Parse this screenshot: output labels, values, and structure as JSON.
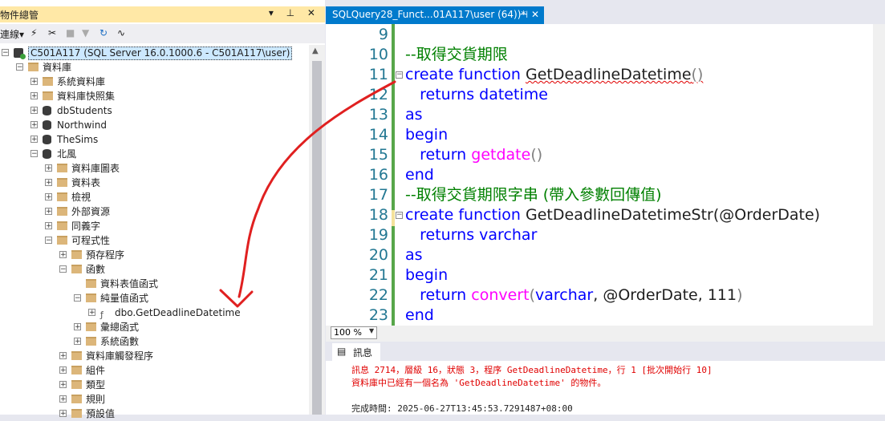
{
  "object_explorer": {
    "title": "物件總管",
    "toolbar_connect": "連線▾",
    "pin_buttons": "▾ ⊥ ✕",
    "tree": [
      {
        "label": "C501A117 (SQL Server 16.0.1000.6 - C501A117\\user)",
        "icon": "server-icon",
        "expand": "−",
        "selected": true
      },
      {
        "label": "資料庫",
        "icon": "folder-icon",
        "expand": "−"
      },
      {
        "label": "系統資料庫",
        "icon": "folder-icon",
        "expand": "+"
      },
      {
        "label": "資料庫快照集",
        "icon": "folder-icon",
        "expand": "+"
      },
      {
        "label": "dbStudents",
        "icon": "database-icon",
        "expand": "+"
      },
      {
        "label": "Northwind",
        "icon": "database-icon",
        "expand": "+"
      },
      {
        "label": "TheSims",
        "icon": "database-icon",
        "expand": "+"
      },
      {
        "label": "北風",
        "icon": "database-icon",
        "expand": "−"
      },
      {
        "label": "資料庫圖表",
        "icon": "folder-icon",
        "expand": "+"
      },
      {
        "label": "資料表",
        "icon": "folder-icon",
        "expand": "+"
      },
      {
        "label": "檢視",
        "icon": "folder-icon",
        "expand": "+"
      },
      {
        "label": "外部資源",
        "icon": "folder-icon",
        "expand": "+"
      },
      {
        "label": "同義字",
        "icon": "folder-icon",
        "expand": "+"
      },
      {
        "label": "可程式性",
        "icon": "folder-icon",
        "expand": "−"
      },
      {
        "label": "預存程序",
        "icon": "folder-icon",
        "expand": "+"
      },
      {
        "label": "函數",
        "icon": "folder-icon",
        "expand": "−"
      },
      {
        "label": "資料表值函式",
        "icon": "folder-icon",
        "expand": ""
      },
      {
        "label": "純量值函式",
        "icon": "folder-icon",
        "expand": "−"
      },
      {
        "label": "dbo.GetDeadlineDatetime",
        "icon": "function-icon",
        "expand": "+"
      },
      {
        "label": "彙總函式",
        "icon": "folder-icon",
        "expand": "+"
      },
      {
        "label": "系統函數",
        "icon": "folder-icon",
        "expand": "+"
      },
      {
        "label": "資料庫觸發程序",
        "icon": "folder-icon",
        "expand": "+"
      },
      {
        "label": "組件",
        "icon": "folder-icon",
        "expand": "+"
      },
      {
        "label": "類型",
        "icon": "folder-icon",
        "expand": "+"
      },
      {
        "label": "規則",
        "icon": "folder-icon",
        "expand": "+"
      },
      {
        "label": "預設值",
        "icon": "folder-icon",
        "expand": "+"
      }
    ]
  },
  "editor": {
    "tab_title": "SQLQuery28_Funct...01A117\\user (64))*",
    "tab_pin": "⊣ ✕",
    "line_numbers": [
      "9",
      "10",
      "11",
      "12",
      "13",
      "14",
      "15",
      "16",
      "17",
      "18",
      "19",
      "20",
      "21",
      "22",
      "23"
    ],
    "lines": {
      "l10": "--取得交貨期限",
      "l11_kw": "create function",
      "l11_name": "GetDeadlineDatetime",
      "l11_paren": "()",
      "l12_kw": "returns datetime",
      "l13": "as",
      "l14": "begin",
      "l15_kw": "return",
      "l15_fn": "getdate",
      "l15_paren": "()",
      "l16": "end",
      "l17": "--取得交貨期限字串 (帶入參數回傳值)",
      "l18_kw": "create function",
      "l18_name": "GetDeadlineDatetimeStr",
      "l18_args": "(@OrderDate)",
      "l19_kw": "returns varchar",
      "l20": "as",
      "l21": "begin",
      "l22_kw": "return",
      "l22_fn": "convert",
      "l22_open": "(",
      "l22_type": "varchar",
      "l22_rest": ", @OrderDate, 111",
      "l22_close": ")",
      "l23": "end"
    },
    "zoom": "100 %"
  },
  "messages_pane": {
    "tab_label": "訊息",
    "error_line1": "訊息 2714，層級 16，狀態 3，程序 GetDeadlineDatetime，行 1 [批次開始行 10]",
    "error_line2": "資料庫中已經有一個名為 'GetDeadlineDatetime' 的物件。",
    "completion": "完成時間: 2025-06-27T13:45:53.7291487+08:00"
  },
  "colors": {
    "keyword": "#0000ff",
    "comment": "#008000",
    "function": "#ff00ff",
    "error": "#e00000",
    "tab_active": "#007acc",
    "title_highlight": "#ffe8a6",
    "annotation_arrow": "#e02020"
  }
}
